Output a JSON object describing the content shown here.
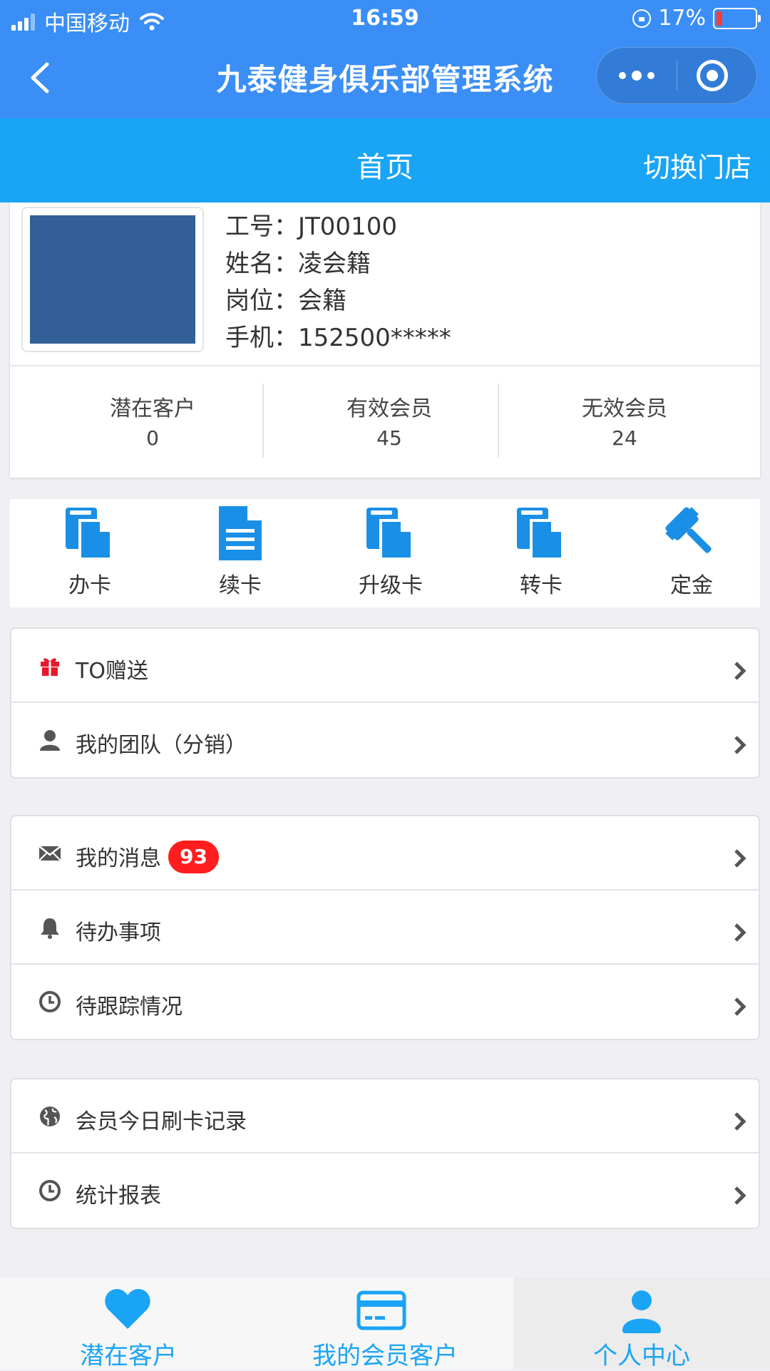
{
  "status_bar": {
    "carrier": "中国移动",
    "time": "16:59",
    "battery_percent": "17%"
  },
  "nav": {
    "title": "九泰健身俱乐部管理系统"
  },
  "subheader": {
    "title": "首页",
    "switch_store": "切换门店"
  },
  "profile": {
    "employee_id_label": "工号：",
    "employee_id": "JT00100",
    "name_label": "姓名：",
    "name": "凌会籍",
    "position_label": "岗位：",
    "position": "会籍",
    "phone_label": "手机：",
    "phone": "152500*****"
  },
  "stats": [
    {
      "label": "潜在客户",
      "value": "0"
    },
    {
      "label": "有效会员",
      "value": "45"
    },
    {
      "label": "无效会员",
      "value": "24"
    }
  ],
  "actions": [
    {
      "label": "办卡",
      "icon": "copy-card-icon"
    },
    {
      "label": "续卡",
      "icon": "document-icon"
    },
    {
      "label": "升级卡",
      "icon": "copy-card-icon"
    },
    {
      "label": "转卡",
      "icon": "copy-card-icon"
    },
    {
      "label": "定金",
      "icon": "gavel-icon"
    }
  ],
  "group1": [
    {
      "label": "TO赠送",
      "icon": "gift-icon"
    },
    {
      "label": "我的团队（分销）",
      "icon": "user-icon"
    }
  ],
  "group2": [
    {
      "label": "我的消息",
      "icon": "envelope-icon",
      "badge": "93"
    },
    {
      "label": "待办事项",
      "icon": "bell-icon"
    },
    {
      "label": "待跟踪情况",
      "icon": "clock-icon"
    }
  ],
  "group3": [
    {
      "label": "会员今日刷卡记录",
      "icon": "globe-icon"
    },
    {
      "label": "统计报表",
      "icon": "clock-icon"
    }
  ],
  "tabbar": [
    {
      "label": "潜在客户",
      "icon": "heart-icon"
    },
    {
      "label": "我的会员客户",
      "icon": "credit-card-icon"
    },
    {
      "label": "个人中心",
      "icon": "person-icon",
      "active": true
    }
  ],
  "colors": {
    "nav_bg": "#3a8ef6",
    "subheader_bg": "#1aa4f5",
    "accent": "#1aa4f5",
    "badge": "#ff1d1d",
    "gift_icon": "#e8192c"
  }
}
